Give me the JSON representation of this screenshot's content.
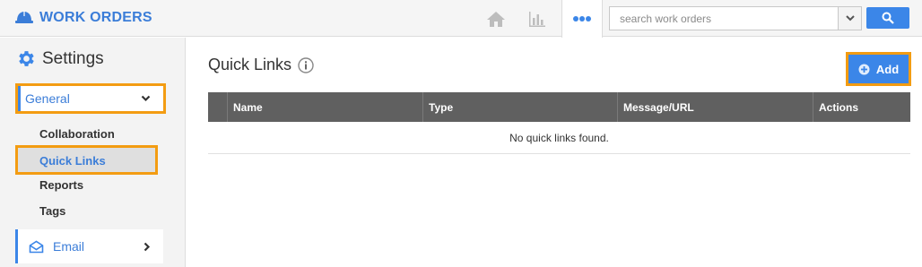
{
  "app": {
    "title": "WORK ORDERS",
    "brand_color": "#3b7dd8"
  },
  "topnav": {
    "home_icon": "home-icon",
    "chart_icon": "bar-chart-icon",
    "more_icon": "more-dots-icon"
  },
  "search": {
    "placeholder": "search work orders",
    "value": "",
    "dropdown_icon": "chevron-down-icon",
    "button_icon": "search-icon"
  },
  "sidebar": {
    "title": "Settings",
    "title_icon": "gear-icon",
    "section": {
      "label": "General",
      "icon": "chevron-down-icon"
    },
    "items": [
      {
        "label": "Collaboration"
      },
      {
        "label": "Quick Links",
        "active": true
      },
      {
        "label": "Reports"
      },
      {
        "label": "Tags"
      }
    ],
    "email": {
      "label": "Email",
      "icon": "envelope-icon",
      "chevron": "chevron-right-icon"
    }
  },
  "main": {
    "title": "Quick Links",
    "info_icon": "info-icon",
    "add_label": "Add",
    "add_icon": "plus-circle-icon",
    "table": {
      "columns": [
        "Name",
        "Type",
        "Message/URL",
        "Actions"
      ],
      "empty_text": "No quick links found."
    }
  },
  "colors": {
    "accent": "#3b86e8",
    "highlight": "#f39c12",
    "header_bg": "#606060"
  }
}
